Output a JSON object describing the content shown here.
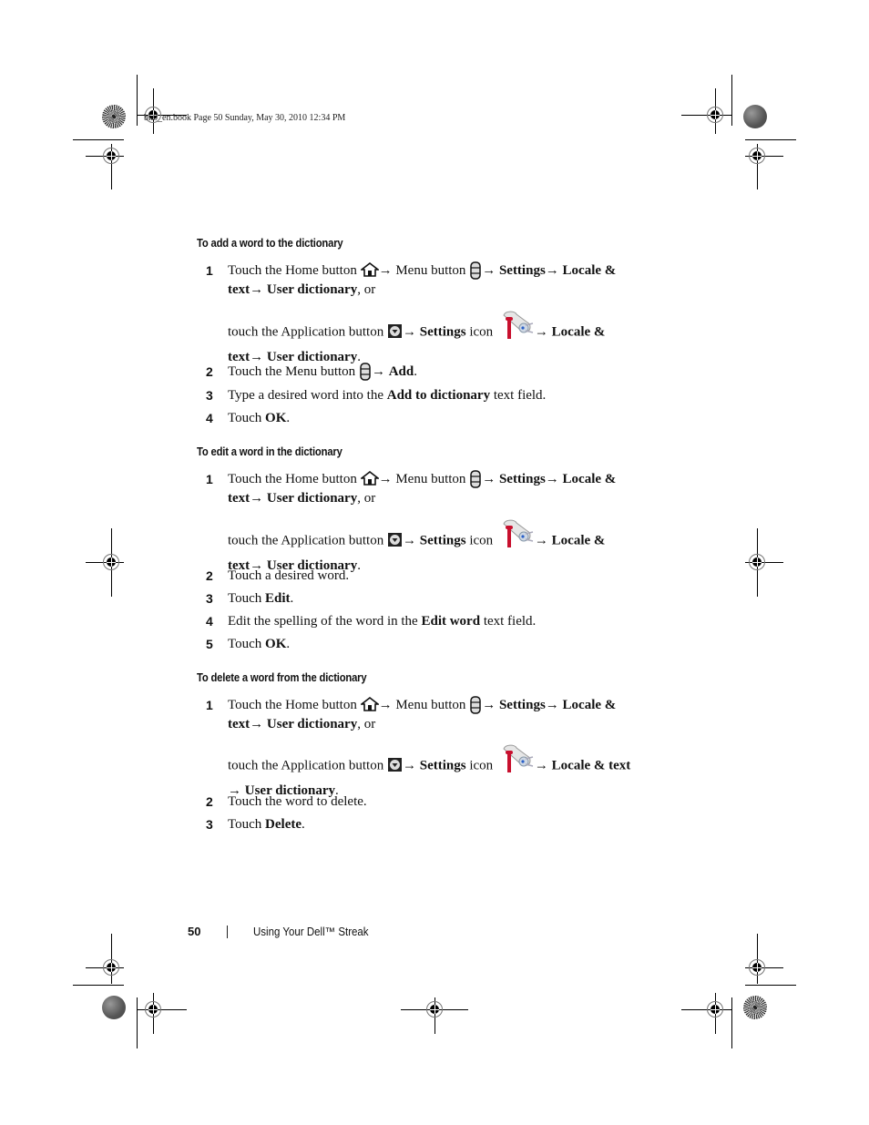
{
  "print_header": "bk0_en.book  Page 50  Sunday, May 30, 2010  12:34 PM",
  "icons": {
    "home": "home-icon",
    "menu": "menu-icon",
    "application": "application-icon",
    "settings": "settings-icon",
    "arrow": "→"
  },
  "sections": [
    {
      "title": "To add a word to the dictionary",
      "steps": [
        {
          "num": "1",
          "line1": {
            "a": "Touch the Home button ",
            "b": "→ Menu button ",
            "c": "→ ",
            "settings": "Settings",
            "d": "→ ",
            "locale": "Locale &",
            "text": "text",
            "e": "→ ",
            "ud": "User dictionary",
            "f": ", or"
          },
          "line2": {
            "a": "touch the Application button ",
            "b": "→ ",
            "settings": "Settings",
            "c": " icon ",
            "d": "→ ",
            "locale": "Locale &",
            "text": "text",
            "e": "→ ",
            "ud": "User dictionary",
            "f": "."
          }
        },
        {
          "num": "2",
          "a": "Touch the Menu button ",
          "b": "→ ",
          "bold": "Add",
          "c": "."
        },
        {
          "num": "3",
          "a": "Type a desired word into the ",
          "bold": "Add to dictionary",
          "c": " text field."
        },
        {
          "num": "4",
          "a": "Touch ",
          "bold": "OK",
          "c": "."
        }
      ]
    },
    {
      "title": "To edit a word in the dictionary",
      "steps": [
        {
          "num": "1",
          "line1": {
            "a": "Touch the Home button ",
            "b": "→ Menu button ",
            "c": "→ ",
            "settings": "Settings",
            "d": "→ ",
            "locale": "Locale &",
            "text": "text",
            "e": "→ ",
            "ud": "User dictionary",
            "f": ", or"
          },
          "line2": {
            "a": "touch the Application button ",
            "b": "→ ",
            "settings": "Settings",
            "c": " icon ",
            "d": "→ ",
            "locale": "Locale &",
            "text": "text",
            "e": "→ ",
            "ud": "User dictionary",
            "f": "."
          }
        },
        {
          "num": "2",
          "a": "Touch a desired word."
        },
        {
          "num": "3",
          "a": "Touch ",
          "bold": "Edit",
          "c": "."
        },
        {
          "num": "4",
          "a": "Edit the spelling of the word in the ",
          "bold": "Edit word",
          "c": " text field."
        },
        {
          "num": "5",
          "a": "Touch ",
          "bold": "OK",
          "c": "."
        }
      ]
    },
    {
      "title": "To delete a word from the dictionary",
      "steps": [
        {
          "num": "1",
          "line1": {
            "a": "Touch the Home button ",
            "b": "→ Menu button ",
            "c": "→ ",
            "settings": "Settings",
            "d": "→ ",
            "locale": "Locale &",
            "text": "text",
            "e": "→ ",
            "ud": "User dictionary",
            "f": ", or"
          },
          "line2": {
            "a": "touch the Application button ",
            "b": "→ ",
            "settings": "Settings",
            "c": " icon ",
            "d": "→ ",
            "locale": "Locale & text",
            "e": "→ ",
            "ud": "User dictionary",
            "f": "."
          }
        },
        {
          "num": "2",
          "a": "Touch the word to delete."
        },
        {
          "num": "3",
          "a": "Touch ",
          "bold": "Delete",
          "c": "."
        }
      ]
    }
  ],
  "footer": {
    "page_number": "50",
    "separator": "|",
    "title": "Using Your Dell™ Streak"
  }
}
